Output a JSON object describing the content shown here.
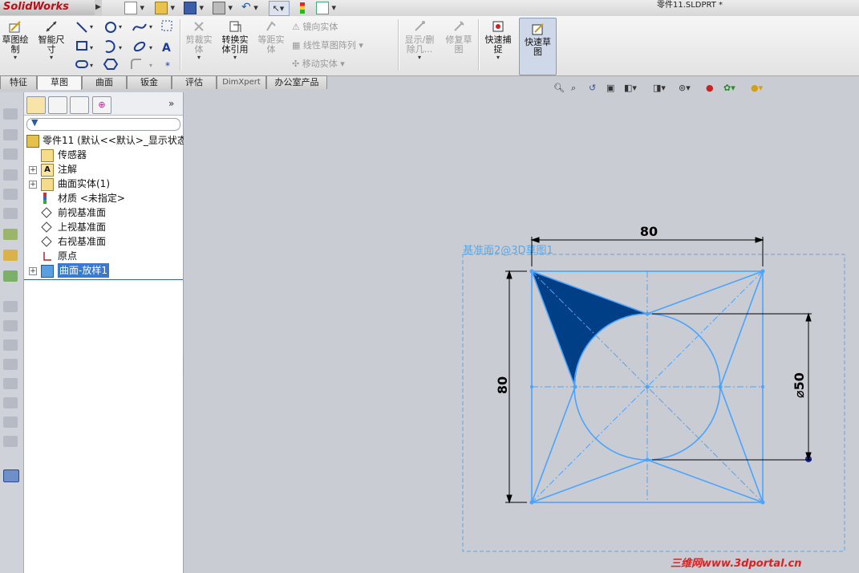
{
  "app": {
    "logo": "SolidWorks",
    "doc_title": "零件11.SLDPRT *"
  },
  "command_manager": {
    "sketch_draw": "草图绘\n制",
    "smart_dimension": "智能尺\n寸",
    "trim": "剪裁实\n体",
    "convert": "转换实\n体引用",
    "offset": "等距实\n体",
    "mirror": "镜向实体",
    "linear_pattern": "线性草图阵列",
    "move": "移动实体",
    "show_delete": "显示/删\n除几...",
    "repair": "修复草\n图",
    "quick_snaps": "快速捕\n捉",
    "rapid_sketch": "快速草\n图"
  },
  "tabs": [
    "特征",
    "草图",
    "曲面",
    "钣金",
    "评估",
    "DimXpert",
    "办公室产品"
  ],
  "active_tab": 1,
  "feature_tree": {
    "root": "零件11    (默认<<默认>_显示状态",
    "items": [
      "传感器",
      "注解",
      "曲面实体(1)",
      "材质 <未指定>",
      "前视基准面",
      "上视基准面",
      "右视基准面",
      "原点",
      "曲面-放样1"
    ]
  },
  "sketch": {
    "plane_label": "基准面2@3D草图1",
    "dim_top": "80",
    "dim_left": "80",
    "dim_dia": "⌀50"
  },
  "watermark": "三维网www.3dportal.cn",
  "colors": {
    "sketch_line": "#4aa3ff",
    "fill": "#003f86",
    "dim": "#000000",
    "plane": "#5aa8e8"
  }
}
